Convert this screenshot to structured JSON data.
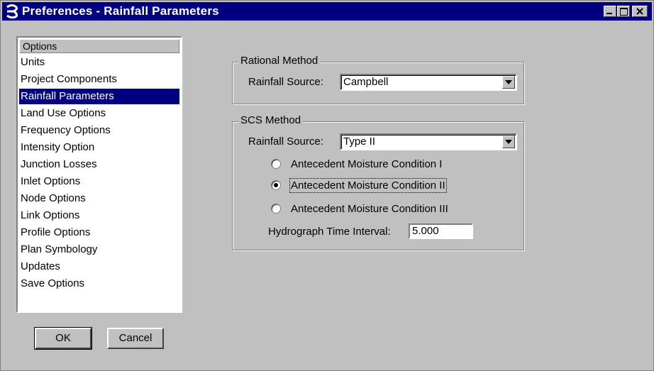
{
  "window": {
    "title": "Preferences - Rainfall Parameters"
  },
  "titlebar_buttons": {
    "minimize": "minimize-icon",
    "maximize": "maximize-icon",
    "close": "close-icon"
  },
  "options": {
    "header": "Options",
    "items": [
      "Units",
      "Project Components",
      "Rainfall Parameters",
      "Land Use Options",
      "Frequency Options",
      "Intensity Option",
      "Junction Losses",
      "Inlet Options",
      "Node Options",
      "Link Options",
      "Profile Options",
      "Plan Symbology",
      "Updates",
      "Save Options"
    ],
    "selected": "Rainfall Parameters"
  },
  "rational": {
    "group_label": "Rational Method",
    "source_label": "Rainfall Source:",
    "source_value": "Campbell"
  },
  "scs": {
    "group_label": "SCS Method",
    "source_label": "Rainfall Source:",
    "source_value": "Type II",
    "radios": [
      {
        "label": "Antecedent Moisture Condition I",
        "checked": false
      },
      {
        "label": "Antecedent Moisture Condition II",
        "checked": true
      },
      {
        "label": "Antecedent Moisture Condition III",
        "checked": false
      }
    ],
    "interval_label": "Hydrograph Time Interval:",
    "interval_value": "5.000"
  },
  "buttons": {
    "ok": "OK",
    "cancel": "Cancel"
  },
  "colors": {
    "titlebar": "#000080",
    "selection": "#000080",
    "face": "#c0c0c0"
  }
}
